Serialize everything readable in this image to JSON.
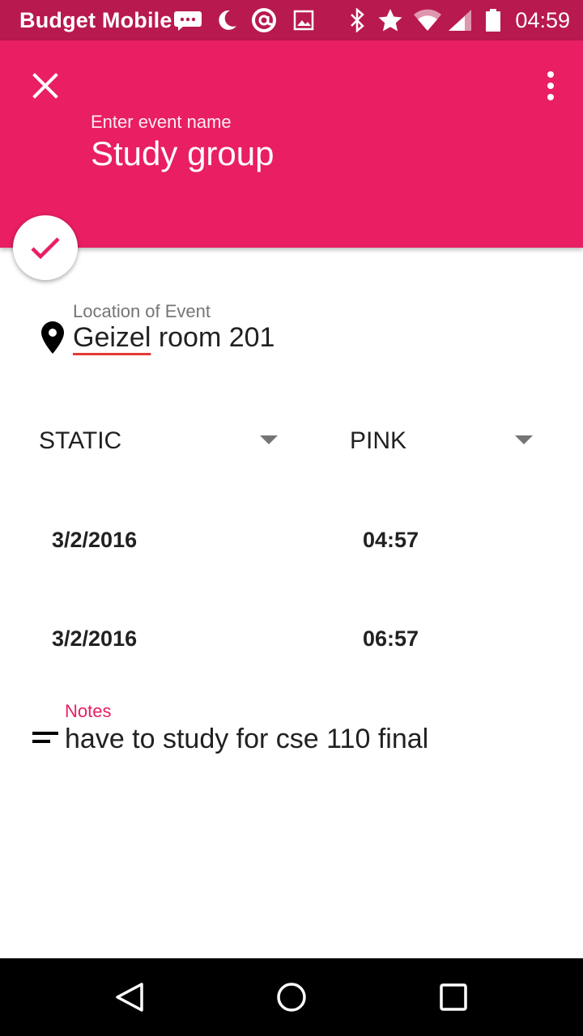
{
  "status_bar": {
    "carrier": "Budget Mobile",
    "time": "04:59",
    "icons": [
      "messenger-icon",
      "moon-icon",
      "at-sign-icon",
      "image-icon",
      "bluetooth-icon",
      "star-icon",
      "wifi-icon",
      "signal-icon",
      "battery-icon"
    ]
  },
  "header": {
    "background_color": "#e91e63",
    "event_name_label": "Enter event name",
    "event_name_value": "Study group",
    "close_icon": "close-icon",
    "menu_icon": "more-vert-icon"
  },
  "fab": {
    "icon": "check-icon",
    "accent": "#e91e63"
  },
  "location": {
    "label": "Location of Event",
    "value_word1": "Geizel",
    "value_rest": " room 201",
    "icon": "location-pin-icon"
  },
  "spinners": {
    "type": {
      "value": "STATIC"
    },
    "color": {
      "value": "PINK"
    }
  },
  "start": {
    "date": "3/2/2016",
    "time": "04:57"
  },
  "end": {
    "date": "3/2/2016",
    "time": "06:57"
  },
  "notes": {
    "label": "Notes",
    "value": "have to study for cse 110 final",
    "icon": "notes-icon"
  },
  "nav_bar": {
    "back_icon": "back-icon",
    "home_icon": "home-icon",
    "recents_icon": "recents-icon"
  }
}
